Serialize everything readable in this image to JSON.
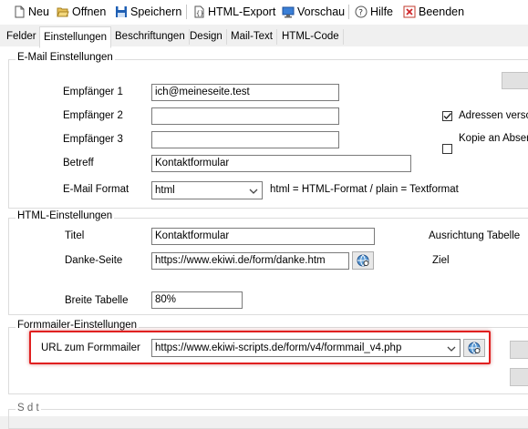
{
  "toolbar": {
    "new_label": "Neu",
    "open_label": "Offnen",
    "save_label": "Speichern",
    "export_label": "HTML-Export",
    "preview_label": "Vorschau",
    "help_label": "Hilfe",
    "exit_label": "Beenden"
  },
  "tabs": [
    "Felder",
    "Einstellungen",
    "Beschriftungen",
    "Design",
    "Mail-Text",
    "HTML-Code"
  ],
  "email": {
    "legend": "E-Mail Einstellungen",
    "recipient1_label": "Empfänger 1",
    "recipient1_value": "ich@meineseite.test",
    "recipient2_label": "Empfänger 2",
    "recipient2_value": "",
    "recipient3_label": "Empfänger 3",
    "recipient3_value": "",
    "subject_label": "Betreff",
    "subject_value": "Kontaktformular",
    "format_label": "E-Mail Format",
    "format_value": "html",
    "format_hint": "html = HTML-Format / plain = Textformat",
    "check1_label": "Adressen versc",
    "check1_checked": true,
    "check2_label": "Kopie an Abser",
    "check2_checked": false
  },
  "html": {
    "legend": "HTML-Einstellungen",
    "title_label": "Titel",
    "title_value": "Kontaktformular",
    "thanks_label": "Danke-Seite",
    "thanks_value": "https://www.ekiwi.de/form/danke.htm",
    "align_label": "Ausrichtung Tabelle",
    "target_label": "Ziel",
    "width_label": "Breite Tabelle",
    "width_value": "80%"
  },
  "formmailer": {
    "legend": "Formmailer-Einstellungen",
    "url_label": "URL zum Formmailer",
    "url_value": "https://www.ekiwi-scripts.de/form/v4/formmail_v4.php"
  },
  "bottom": {
    "legend_partial": "S      d    t"
  },
  "colors": {
    "highlight": "#e02020",
    "toolbar_icon_blue": "#1e5fb4"
  }
}
